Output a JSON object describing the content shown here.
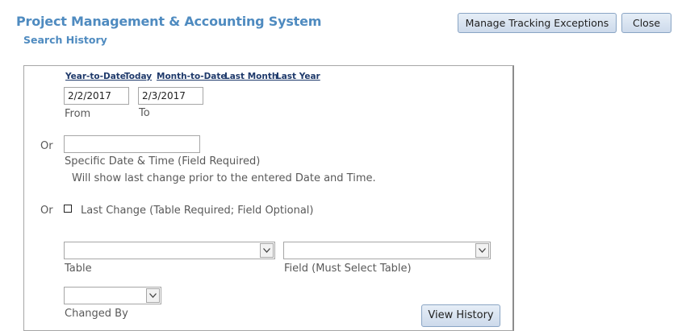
{
  "header": {
    "app_title": "Project Management & Accounting System",
    "subtitle": "Search History",
    "manage_exceptions_label": "Manage Tracking Exceptions",
    "close_label": "Close"
  },
  "quick_ranges": [
    "Year-to-Date",
    "Today",
    "Month-to-Date",
    "Last Month",
    "Last Year"
  ],
  "date_range": {
    "from_value": "2/2/2017",
    "to_value": "2/3/2017",
    "from_label": "From",
    "to_label": "To"
  },
  "specific": {
    "or_label": "Or",
    "value": "",
    "label": "Specific Date & Time (Field Required)",
    "note": "Will show last change prior to the entered Date and Time."
  },
  "last_change": {
    "or_label": "Or",
    "checked": false,
    "label": "Last Change (Table Required; Field Optional)"
  },
  "filters": {
    "table_label": "Table",
    "table_value": "",
    "field_label": "Field (Must Select Table)",
    "field_value": "",
    "changed_by_label": "Changed By",
    "changed_by_value": ""
  },
  "view_history_label": "View History",
  "colors": {
    "title_blue": "#4f8bc0",
    "link_navy": "#1f3a6b",
    "button_gradient_top": "#e6eef7",
    "button_gradient_bottom": "#cddaeb"
  }
}
